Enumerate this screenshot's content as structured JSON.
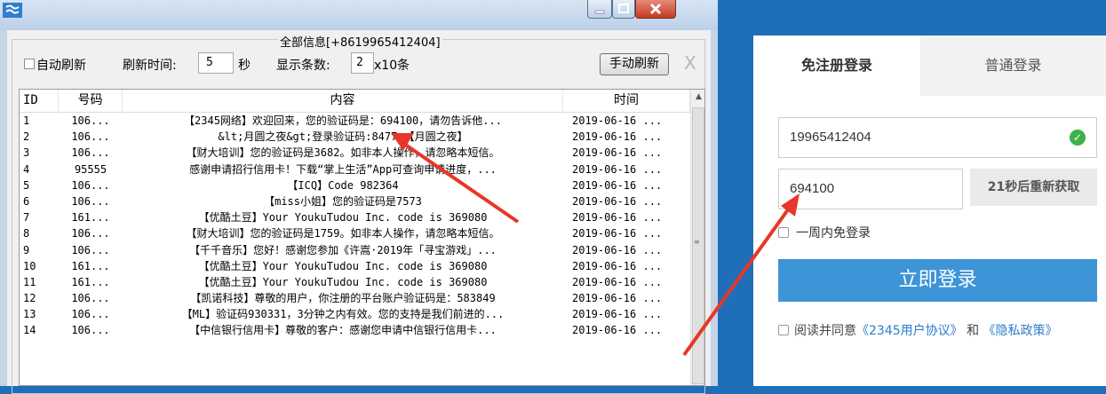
{
  "window": {
    "group_title": "全部信息[+8619965412404]"
  },
  "toolbar": {
    "auto_refresh_label": "自动刷新",
    "refresh_time_label": "刷新时间:",
    "refresh_time_value": "5",
    "seconds_unit": "秒",
    "display_count_label": "显示条数:",
    "display_count_value": "2",
    "display_count_unit": "x10条",
    "manual_refresh_label": "手动刷新",
    "close_label": "X"
  },
  "table": {
    "headers": [
      "ID",
      "号码",
      "内容",
      "时间"
    ],
    "rows": [
      {
        "id": "1",
        "number": "106...",
        "content": "【2345网络】欢迎回来，您的验证码是：694100，请勿告诉他...",
        "time": "2019-06-16 ..."
      },
      {
        "id": "2",
        "number": "106...",
        "content": "&lt;月圆之夜&gt;登录验证码:8477 【月圆之夜】",
        "time": "2019-06-16 ..."
      },
      {
        "id": "3",
        "number": "106...",
        "content": "【财大培训】您的验证码是3682。如非本人操作，请忽略本短信。",
        "time": "2019-06-16 ..."
      },
      {
        "id": "4",
        "number": "95555",
        "content": "感谢申请招行信用卡！下载“掌上生活”App可查询申请进度，...",
        "time": "2019-06-16 ..."
      },
      {
        "id": "5",
        "number": "106...",
        "content": "【ICQ】Code 982364",
        "time": "2019-06-16 ..."
      },
      {
        "id": "6",
        "number": "106...",
        "content": "【miss小姐】您的验证码是7573",
        "time": "2019-06-16 ..."
      },
      {
        "id": "7",
        "number": "161...",
        "content": "【优酷土豆】Your YoukuTudou Inc. code is 369080",
        "time": "2019-06-16 ..."
      },
      {
        "id": "8",
        "number": "106...",
        "content": "【财大培训】您的验证码是1759。如非本人操作，请忽略本短信。",
        "time": "2019-06-16 ..."
      },
      {
        "id": "9",
        "number": "106...",
        "content": "【千千音乐】您好！感谢您参加《许嵩·2019年「寻宝游戏」...",
        "time": "2019-06-16 ..."
      },
      {
        "id": "10",
        "number": "161...",
        "content": "【优酷土豆】Your YoukuTudou Inc. code is 369080",
        "time": "2019-06-16 ..."
      },
      {
        "id": "11",
        "number": "161...",
        "content": "【优酷土豆】Your YoukuTudou Inc. code is 369080",
        "time": "2019-06-16 ..."
      },
      {
        "id": "12",
        "number": "106...",
        "content": "【凯诺科技】尊敬的用户，你注册的平台账户验证码是：583849",
        "time": "2019-06-16 ..."
      },
      {
        "id": "13",
        "number": "106...",
        "content": "【ML】验证码930331，3分钟之内有效。您的支持是我们前进的...",
        "time": "2019-06-16 ..."
      },
      {
        "id": "14",
        "number": "106...",
        "content": "【中信银行信用卡】尊敬的客户：感谢您申请中信银行信用卡...",
        "time": "2019-06-16 ..."
      }
    ]
  },
  "login": {
    "tab_free": "免注册登录",
    "tab_normal": "普通登录",
    "phone_value": "19965412404",
    "code_value": "694100",
    "resend_label": "21秒后重新获取",
    "keep_login_label": "一周内免登录",
    "login_button": "立即登录",
    "agree_prefix": "阅读并同意",
    "agree_link1": "《2345用户协议》",
    "agree_mid": "和",
    "agree_link2": "《隐私政策》"
  },
  "colors": {
    "accent_blue": "#3d95d8",
    "background_blue": "#1f6fb8",
    "arrow_red": "#e8362a",
    "link_blue": "#2a7dcc"
  }
}
